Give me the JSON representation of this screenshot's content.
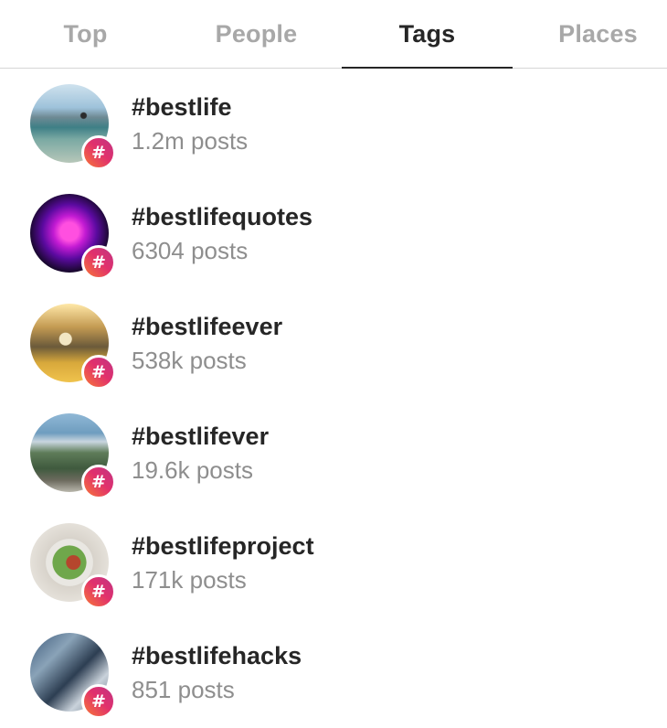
{
  "tabs": {
    "items": [
      {
        "label": "Top",
        "active": false
      },
      {
        "label": "People",
        "active": false
      },
      {
        "label": "Tags",
        "active": true
      },
      {
        "label": "Places",
        "active": false
      }
    ]
  },
  "badge_symbol": "#",
  "results": [
    {
      "tag": "#bestlife",
      "count": "1.2m posts",
      "thumb_icon": "beach-photo"
    },
    {
      "tag": "#bestlifequotes",
      "count": "6304 posts",
      "thumb_icon": "purple-heart-photo"
    },
    {
      "tag": "#bestlifeever",
      "count": "538k posts",
      "thumb_icon": "person-in-field-photo"
    },
    {
      "tag": "#bestlifever",
      "count": "19.6k posts",
      "thumb_icon": "mountain-lake-photo"
    },
    {
      "tag": "#bestlifeproject",
      "count": "171k posts",
      "thumb_icon": "salad-bowl-photo"
    },
    {
      "tag": "#bestlifehacks",
      "count": "851 posts",
      "thumb_icon": "gadgets-photo"
    }
  ],
  "colors": {
    "active_tab": "#262626",
    "inactive_tab": "#a8a8a8",
    "secondary_text": "#8e8e8e",
    "badge_gradient_start": "#f77737",
    "badge_gradient_end": "#c13584"
  }
}
